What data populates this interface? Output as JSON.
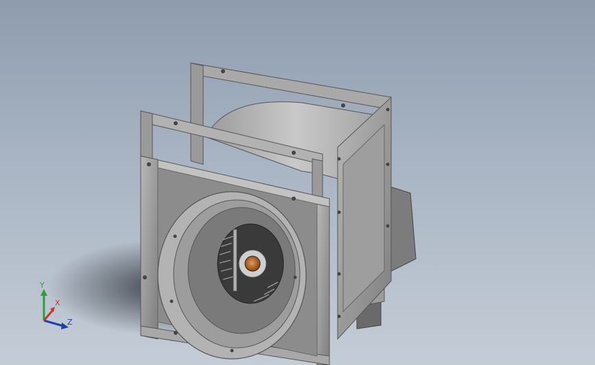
{
  "viewport": {
    "background_top": "#8e9cae",
    "background_bottom": "#c4ccd6"
  },
  "model": {
    "metal_color": "#8f8f8f",
    "metal_dark": "#5a5a5a",
    "metal_light": "#c8c8c8",
    "hub_color": "#b86a2a"
  },
  "triad": {
    "x_label": "X",
    "y_label": "Y",
    "z_label": "Z",
    "x_color": "#c0392b",
    "y_color": "#2e9e3a",
    "z_color": "#1f3fae"
  }
}
